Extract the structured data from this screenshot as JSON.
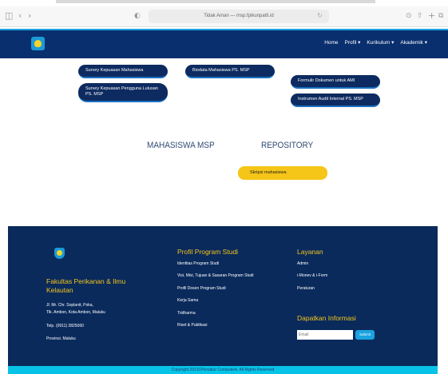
{
  "browser": {
    "url": "Tidak Aman — msp.fpikunpatti.id",
    "icons": [
      "sidebar-icon",
      "back-icon",
      "forward-icon",
      "privacy-shield-icon",
      "reload-icon",
      "download-icon",
      "share-icon",
      "new-tab-icon",
      "tabs-overview-icon"
    ]
  },
  "navbar": {
    "items": [
      "Home",
      "Profil ▾",
      "Kurikulum ▾",
      "Akademik ▾"
    ]
  },
  "links": {
    "survey_mahasiswa": "Survey Kepuasan Mahasiswa",
    "survey_pengguna_1": "Survey Kepuasan Pengguna Lulusan",
    "survey_pengguna_2": "PS. MSP",
    "biodata": "Biodata Mahasiswa PS. MSP",
    "formulir": "Formulir Dokumen untuk AMI",
    "instrumen": "Instrumen Audit Internal PS. MSP"
  },
  "sections": {
    "mahasiswa": "MAHASISWA MSP",
    "repository": "REPOSITORY",
    "skripsi": "Skripsi mahasiswa"
  },
  "footer": {
    "faculty_line1": "Fakultas Perikanan & Ilmu",
    "faculty_line2": "Kelautan",
    "address1": "Jl. Mr. Chr. Soplanit, Poka,",
    "address2": "Tlk. Ambon, Kota Ambon, Maluku",
    "phone": "Telp. (0911) 3825060",
    "province": "Provinsi. Maluku",
    "profil_title": "Profil Program Studi",
    "profil_links": [
      "Identitas Program Studi",
      "Visi, Misi, Tujuan & Sasaran Program Studi",
      "Profil Dosen Program Studi",
      "Kerja Sama",
      "Tridharma",
      "Riset & Publikasi"
    ],
    "layanan_title": "Layanan",
    "layanan_links": [
      "Admin",
      "i-Monev & i-Form",
      "Peraturan"
    ],
    "info_title": "Dapatkan Informasi",
    "email_placeholder": "Email",
    "submit_label": "Submit",
    "copyright": "Copyright 2021©Penabur Computerk. All Rights Reserved"
  },
  "colors": {
    "navbar": "#0a2f6e",
    "pill": "#0d2b60",
    "accent_yellow": "#f5c518",
    "footer": "#0a2a5c",
    "copyright_bar": "#08c3e8"
  }
}
